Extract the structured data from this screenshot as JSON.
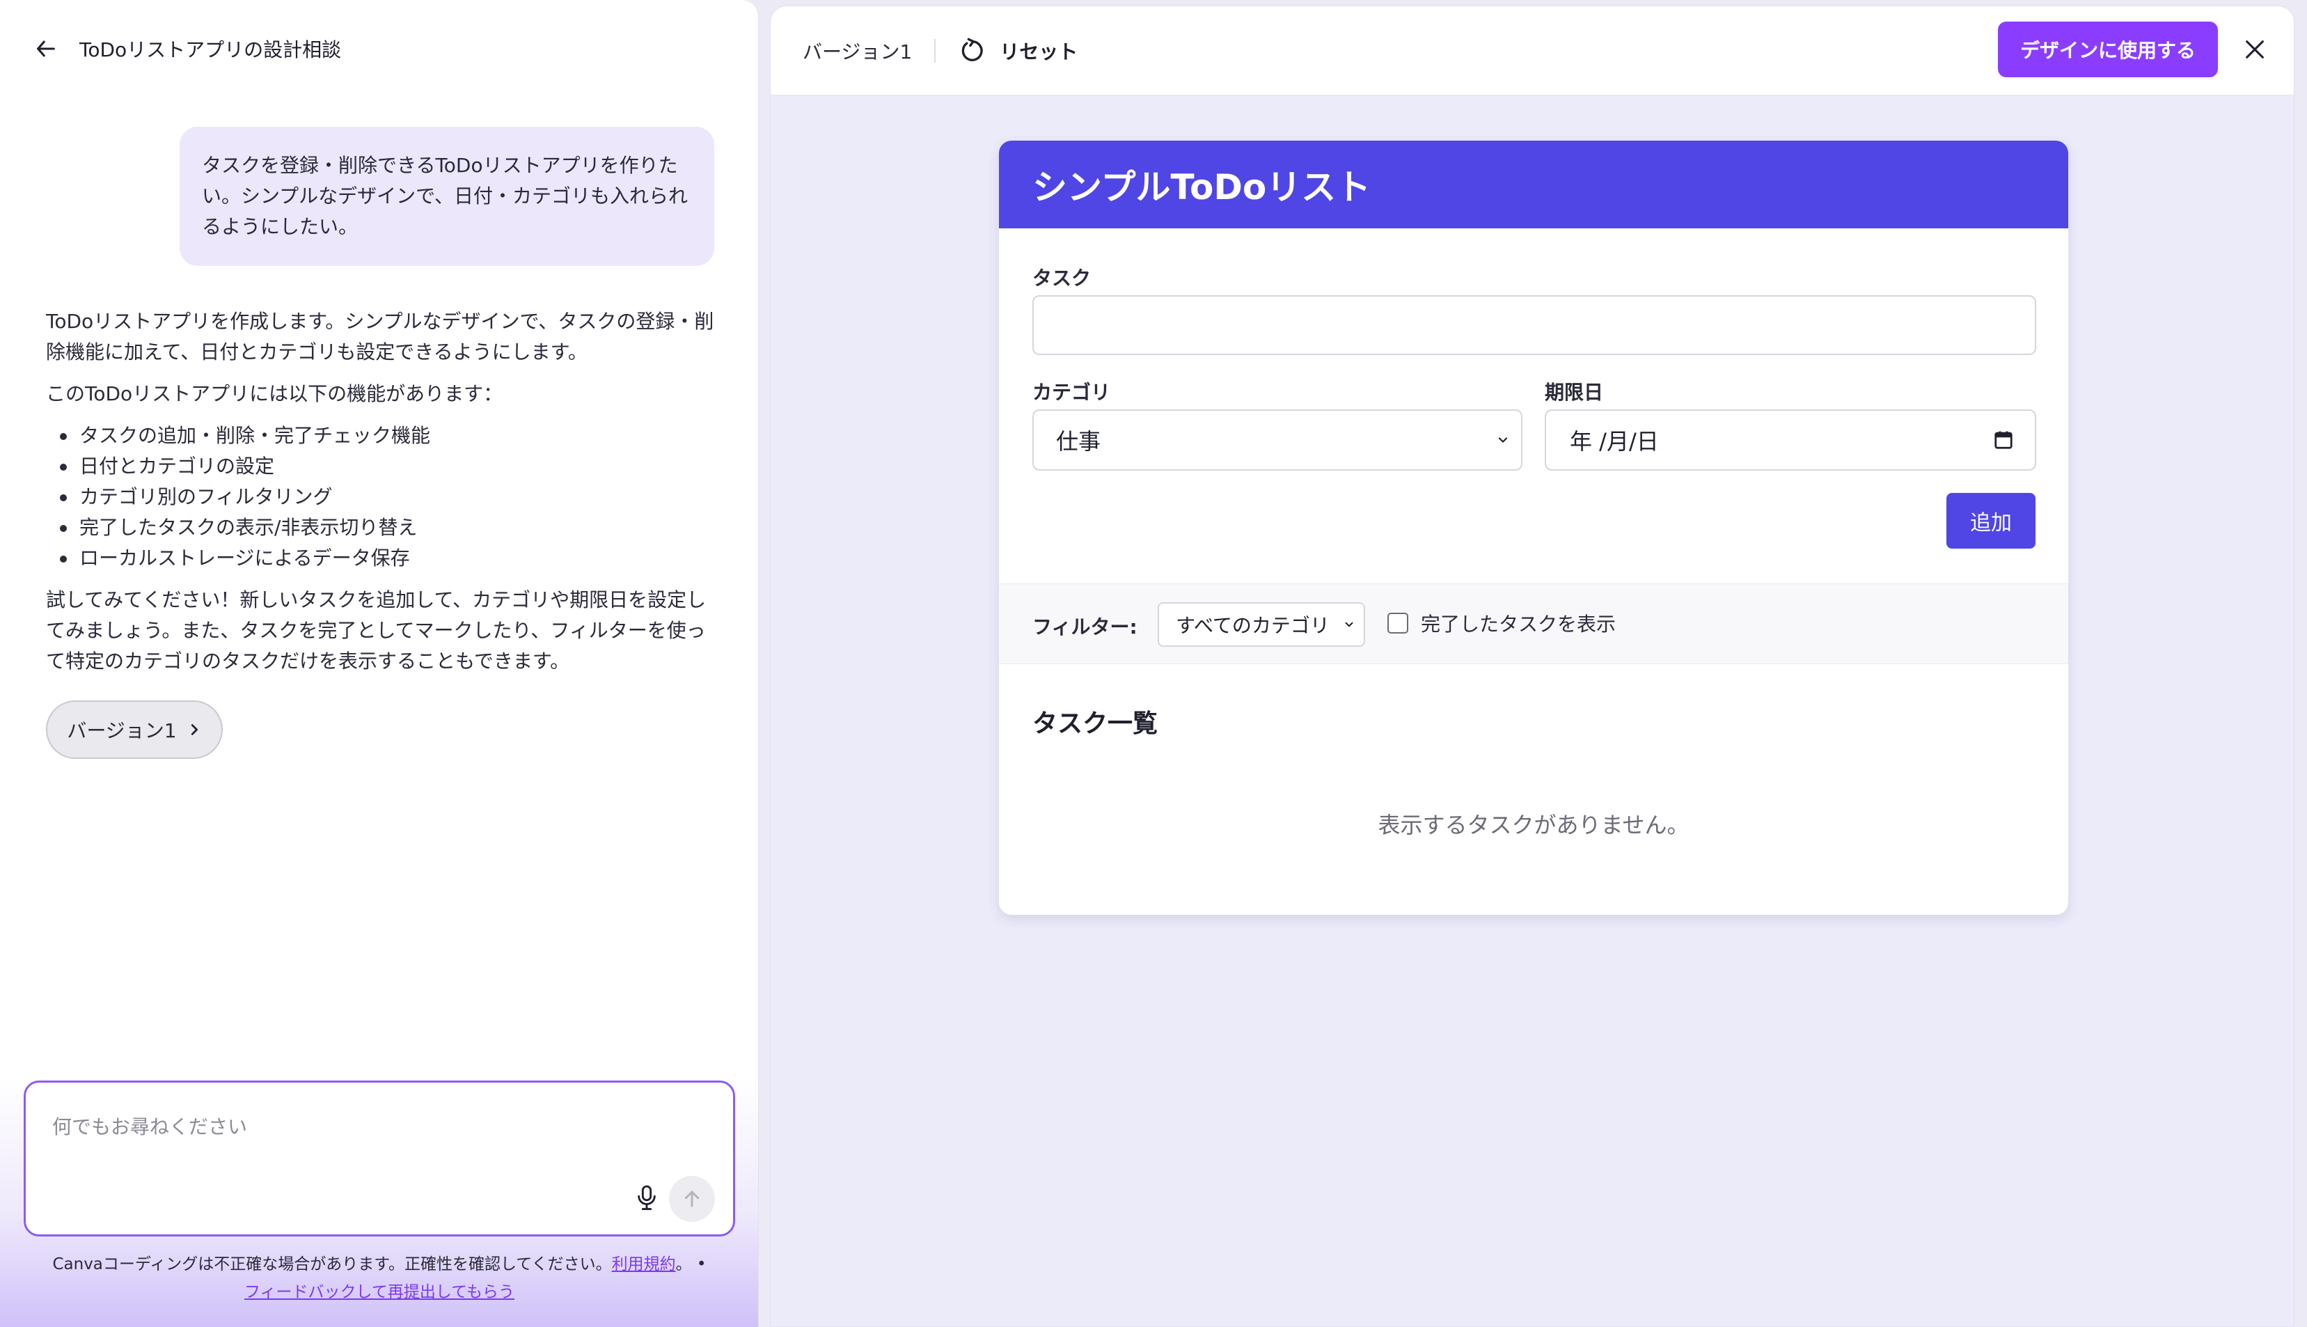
{
  "chat": {
    "title": "ToDoリストアプリの設計相談",
    "user_message": "タスクを登録・削除できるToDoリストアプリを作りたい。シンプルなデザインで、日付・カテゴリも入れられるようにしたい。",
    "assistant": {
      "intro": "ToDoリストアプリを作成します。シンプルなデザインで、タスクの登録・削除機能に加えて、日付とカテゴリも設定できるようにします。",
      "features_lead": "このToDoリストアプリには以下の機能があります：",
      "features": [
        "タスクの追加・削除・完了チェック機能",
        "日付とカテゴリの設定",
        "カテゴリ別のフィルタリング",
        "完了したタスクの表示/非表示切り替え",
        "ローカルストレージによるデータ保存"
      ],
      "closing": "試してみてください！新しいタスクを追加して、カテゴリや期限日を設定してみましょう。また、タスクを完了としてマークしたり、フィルターを使って特定のカテゴリのタスクだけを表示することもできます。"
    },
    "version_chip": "バージョン1",
    "input_placeholder": "何でもお尋ねください",
    "disclaimer_text": "Canvaコーディングは不正確な場合があります。正確性を確認してください。",
    "terms_link": "利用規約",
    "terms_suffix": "。 •",
    "feedback_link": "フィードバックして再提出してもらう"
  },
  "preview": {
    "version_label": "バージョン1",
    "reset_label": "リセット",
    "use_design_label": "デザインに使用する"
  },
  "todo_app": {
    "title": "シンプルToDoリスト",
    "task_label": "タスク",
    "task_value": "",
    "category_label": "カテゴリ",
    "category_value": "仕事",
    "due_label": "期限日",
    "due_placeholder": "年 /月/日",
    "add_button": "追加",
    "filter_label": "フィルター:",
    "filter_value": "すべてのカテゴリ",
    "show_done_label": "完了したタスクを表示",
    "show_done_checked": false,
    "list_title": "タスク一覧",
    "empty_message": "表示するタスクがありません。"
  },
  "colors": {
    "accent_purple": "#8b3dff",
    "app_header": "#4f46e5",
    "user_bubble": "#ece7fb"
  }
}
